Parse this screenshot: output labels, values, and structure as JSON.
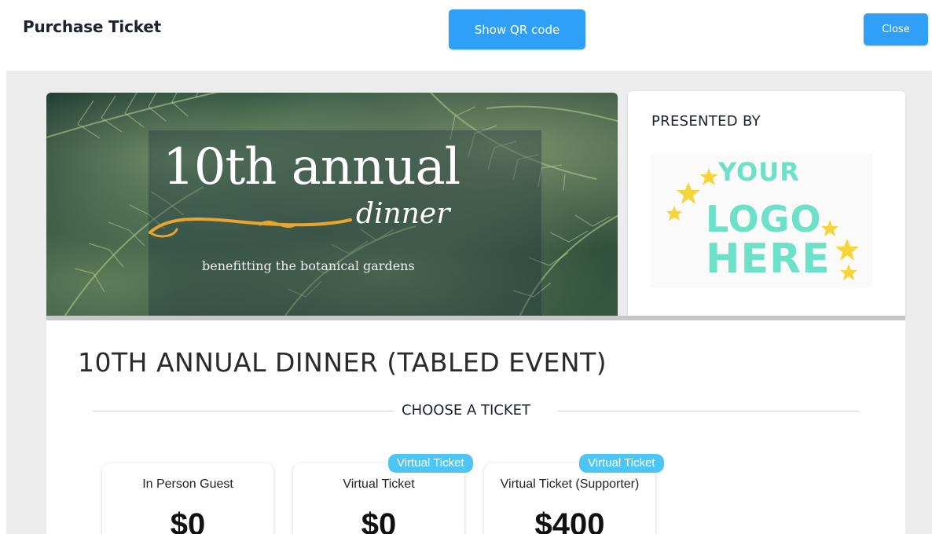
{
  "header": {
    "title": "Purchase Ticket",
    "qr_label": "Show QR code",
    "close_label": "Close"
  },
  "banner": {
    "headline": "10th annual",
    "script": "dinner",
    "subtitle": "benefitting the botanical gardens"
  },
  "sponsor": {
    "heading": "PRESENTED BY",
    "logo_lines": [
      "YOUR",
      "LOGO",
      "HERE"
    ]
  },
  "event": {
    "title": "10TH ANNUAL DINNER (TABLED EVENT)",
    "choose_label": "CHOOSE A TICKET"
  },
  "tickets": [
    {
      "name": "In Person Guest",
      "price": "$0",
      "badge": ""
    },
    {
      "name": "Virtual Ticket",
      "price": "$0",
      "badge": "Virtual Ticket"
    },
    {
      "name": "Virtual Ticket (Supporter)",
      "price": "$400",
      "badge": "Virtual Ticket"
    }
  ],
  "colors": {
    "primary_button": "#2f9ff8",
    "badge": "#4dc6f5",
    "logo_teal": "#6de0c8",
    "logo_star": "#f7d53a"
  }
}
